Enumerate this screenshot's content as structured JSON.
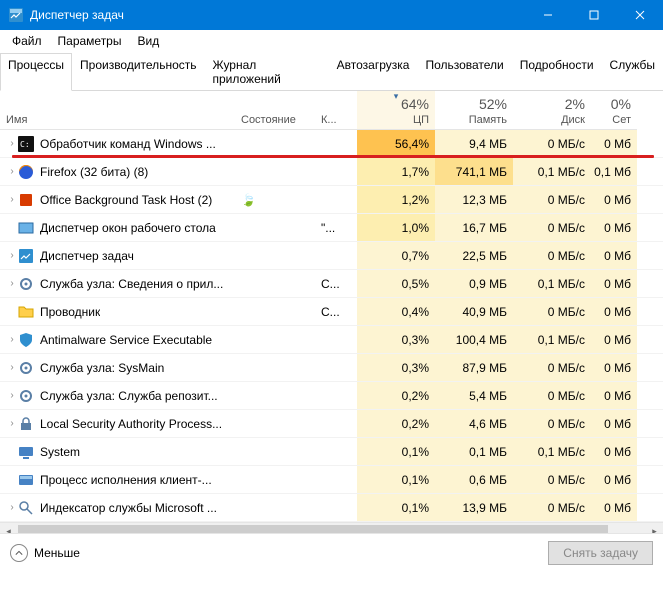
{
  "window": {
    "title": "Диспетчер задач"
  },
  "menu": [
    "Файл",
    "Параметры",
    "Вид"
  ],
  "tabs": [
    "Процессы",
    "Производительность",
    "Журнал приложений",
    "Автозагрузка",
    "Пользователи",
    "Подробности",
    "Службы"
  ],
  "active_tab": 0,
  "columns": {
    "name": "Имя",
    "status": "Состояние",
    "key": "К...",
    "cpu": {
      "pct": "64%",
      "label": "ЦП"
    },
    "mem": {
      "pct": "52%",
      "label": "Память"
    },
    "disk": {
      "pct": "2%",
      "label": "Диск"
    },
    "net": {
      "pct": "0%",
      "label": "Сет"
    }
  },
  "rows": [
    {
      "exp": true,
      "icon": "cmd",
      "name": "Обработчик команд Windows ...",
      "status": "",
      "cpu": "56,4%",
      "mem": "9,4 МБ",
      "disk": "0 МБ/с",
      "net": "0 Мб",
      "cpu_heat": "hi",
      "mem_heat": "",
      "highlight_red": true
    },
    {
      "exp": true,
      "icon": "firefox",
      "name": "Firefox (32 бита) (8)",
      "status": "",
      "cpu": "1,7%",
      "mem": "741,1 МБ",
      "disk": "0,1 МБ/с",
      "net": "0,1 Мб",
      "cpu_heat": "",
      "mem_heat": "hi"
    },
    {
      "exp": true,
      "icon": "office",
      "name": "Office Background Task Host (2)",
      "status": "",
      "cpu": "1,2%",
      "mem": "12,3 МБ",
      "disk": "0 МБ/с",
      "net": "0 Мб",
      "leaf": true
    },
    {
      "exp": false,
      "icon": "dwm",
      "name": "Диспетчер окон рабочего стола",
      "status": "\"...",
      "cpu": "1,0%",
      "mem": "16,7 МБ",
      "disk": "0 МБ/с",
      "net": "0 Мб"
    },
    {
      "exp": true,
      "icon": "taskmgr",
      "name": "Диспетчер задач",
      "status": "",
      "cpu": "0,7%",
      "mem": "22,5 МБ",
      "disk": "0 МБ/с",
      "net": "0 Мб"
    },
    {
      "exp": true,
      "icon": "svc",
      "name": "Служба узла: Сведения о прил...",
      "status": "С...",
      "cpu": "0,5%",
      "mem": "0,9 МБ",
      "disk": "0,1 МБ/с",
      "net": "0 Мб"
    },
    {
      "exp": false,
      "icon": "explorer",
      "name": "Проводник",
      "status": "С...",
      "cpu": "0,4%",
      "mem": "40,9 МБ",
      "disk": "0 МБ/с",
      "net": "0 Мб"
    },
    {
      "exp": true,
      "icon": "defender",
      "name": "Antimalware Service Executable",
      "status": "",
      "cpu": "0,3%",
      "mem": "100,4 МБ",
      "disk": "0,1 МБ/с",
      "net": "0 Мб"
    },
    {
      "exp": true,
      "icon": "svc",
      "name": "Служба узла: SysMain",
      "status": "",
      "cpu": "0,3%",
      "mem": "87,9 МБ",
      "disk": "0 МБ/с",
      "net": "0 Мб"
    },
    {
      "exp": true,
      "icon": "svc",
      "name": "Служба узла: Служба репозит...",
      "status": "",
      "cpu": "0,2%",
      "mem": "5,4 МБ",
      "disk": "0 МБ/с",
      "net": "0 Мб"
    },
    {
      "exp": true,
      "icon": "lsa",
      "name": "Local Security Authority Process...",
      "status": "",
      "cpu": "0,2%",
      "mem": "4,6 МБ",
      "disk": "0 МБ/с",
      "net": "0 Мб"
    },
    {
      "exp": false,
      "icon": "system",
      "name": "System",
      "status": "",
      "cpu": "0,1%",
      "mem": "0,1 МБ",
      "disk": "0,1 МБ/с",
      "net": "0 Мб"
    },
    {
      "exp": false,
      "icon": "ctf",
      "name": "Процесс исполнения клиент-...",
      "status": "",
      "cpu": "0,1%",
      "mem": "0,6 МБ",
      "disk": "0 МБ/с",
      "net": "0 Мб"
    },
    {
      "exp": true,
      "icon": "search",
      "name": "Индексатор службы Microsoft ...",
      "status": "",
      "cpu": "0,1%",
      "mem": "13,9 МБ",
      "disk": "0 МБ/с",
      "net": "0 Мб"
    }
  ],
  "footer": {
    "fewer": "Меньше",
    "endtask": "Снять задачу"
  }
}
